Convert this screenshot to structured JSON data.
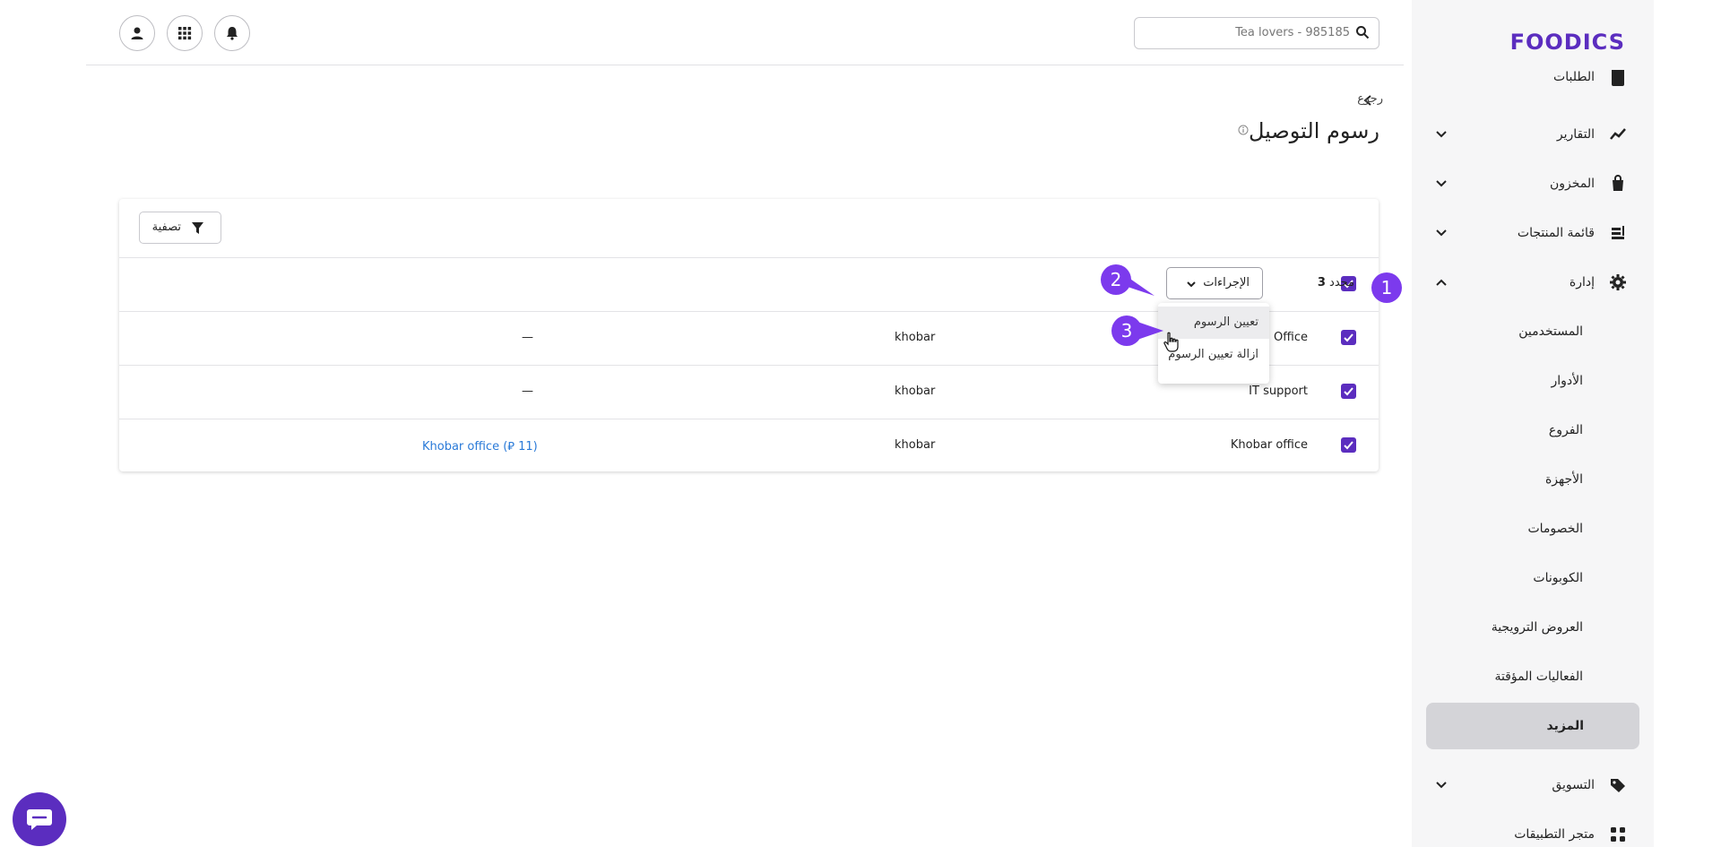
{
  "sidebar": {
    "logo": "FOODICS",
    "items": [
      {
        "label": "الطلبات",
        "icon": "orders-icon"
      },
      {
        "label": "التقارير",
        "icon": "reports-icon"
      },
      {
        "label": "المخزون",
        "icon": "inventory-icon"
      },
      {
        "label": "قائمة المنتجات",
        "icon": "menu-icon"
      },
      {
        "label": "إدارة",
        "icon": "gear-icon"
      },
      {
        "label": "المستخدمين"
      },
      {
        "label": "الأدوار"
      },
      {
        "label": "الفروع"
      },
      {
        "label": "الأجهزة"
      },
      {
        "label": "الخصومات"
      },
      {
        "label": "الكوبونات"
      },
      {
        "label": "العروض الترويجية"
      },
      {
        "label": "الفعاليات المؤقتة"
      },
      {
        "label": "المزيد"
      },
      {
        "label": "التسويق",
        "icon": "tag-icon"
      },
      {
        "label": "متجر التطبيقات",
        "icon": "apps-icon"
      }
    ]
  },
  "header": {
    "search_value": "Tea lovers - 985185"
  },
  "page": {
    "back_label": "رجوع",
    "title": "رسوم التوصيل"
  },
  "toolbar": {
    "filter_label": "تصفية",
    "selected_count": "3",
    "selected_suffix": "محدد",
    "actions_label": "الإجراءات"
  },
  "dropdown": {
    "items": [
      "تعيين الرسوم",
      "ازالة تعيين الرسوم"
    ]
  },
  "table": {
    "rows": [
      {
        "name": "Office",
        "reference": "khobar",
        "branch": "—"
      },
      {
        "name": "IT support",
        "reference": "khobar",
        "branch": "—"
      },
      {
        "name": "Khobar office",
        "reference": "khobar",
        "branch": "Khobar office (⃁ 11)"
      }
    ]
  },
  "steps": [
    "1",
    "2",
    "3"
  ],
  "colors": {
    "brand": "#5b2dbf",
    "step_marker": "#7c3aed",
    "link": "#2a7ad8"
  }
}
